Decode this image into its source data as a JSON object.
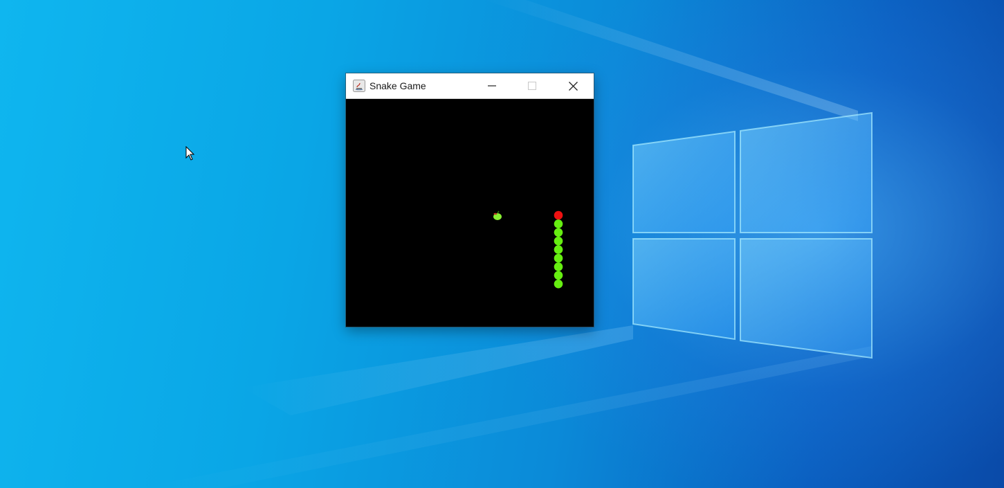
{
  "window": {
    "title": "Snake Game",
    "controls": [
      "minimize-icon",
      "maximize-icon",
      "close-icon"
    ]
  },
  "game": {
    "board_color": "#000000",
    "snake_head_color": "#ee1111",
    "snake_body_color": "#66ee11",
    "food_color": "#88ee33",
    "snake_length": 9,
    "direction": "up"
  },
  "colors": {
    "desktop_accent": "#0aa6e6",
    "title_bar": "#ffffff"
  }
}
